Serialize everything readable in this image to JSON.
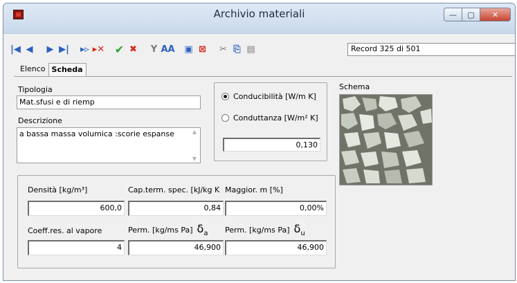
{
  "window": {
    "title": "Archivio materiali"
  },
  "record_info": "Record 325 di 501",
  "tabs": [
    "Elenco",
    "Scheda"
  ],
  "form": {
    "tipologia_label": "Tipologia",
    "tipologia_value": "Mat.sfusi e di riemp",
    "descrizione_label": "Descrizione",
    "descrizione_value": "a bassa massa volumica :scorie espanse",
    "radio_conducibilita": "Conducibilità [W/m K]",
    "radio_conduttanza": "Conduttanza [W/m² K]",
    "conducibilita_value": "0,130",
    "schema_label": "Schema",
    "densita_label": "Densità [kg/m³]",
    "densita_value": "600,0",
    "capterm_label": "Cap.term. spec. [kJ/kg K",
    "capterm_value": "0,84",
    "maggior_label": "Maggior. m [%]",
    "maggior_value": "0,00%",
    "coeff_label": "Coeff.res. al vapore",
    "coeff_value": "4",
    "perm_a_label": "Perm. [kg/ms Pa]",
    "perm_a_symbol": "δ",
    "perm_a_sub": "a",
    "perm_a_value": "46,900",
    "perm_u_label": "Perm. [kg/ms Pa]",
    "perm_u_symbol": "δ",
    "perm_u_sub": "u",
    "perm_u_value": "46,900"
  },
  "selected_radio": "conducibilita",
  "icons": {
    "first": "|◀",
    "prev": "◀",
    "next": "▶",
    "last": "▶|",
    "add": "▸▹",
    "delete": "▸✕",
    "confirm": "✔",
    "cancel": "✖",
    "filter": "Y",
    "find": "AA",
    "print": "▣",
    "close": "⊠",
    "cut": "✂",
    "copy": "⎘",
    "paste": "▤"
  }
}
